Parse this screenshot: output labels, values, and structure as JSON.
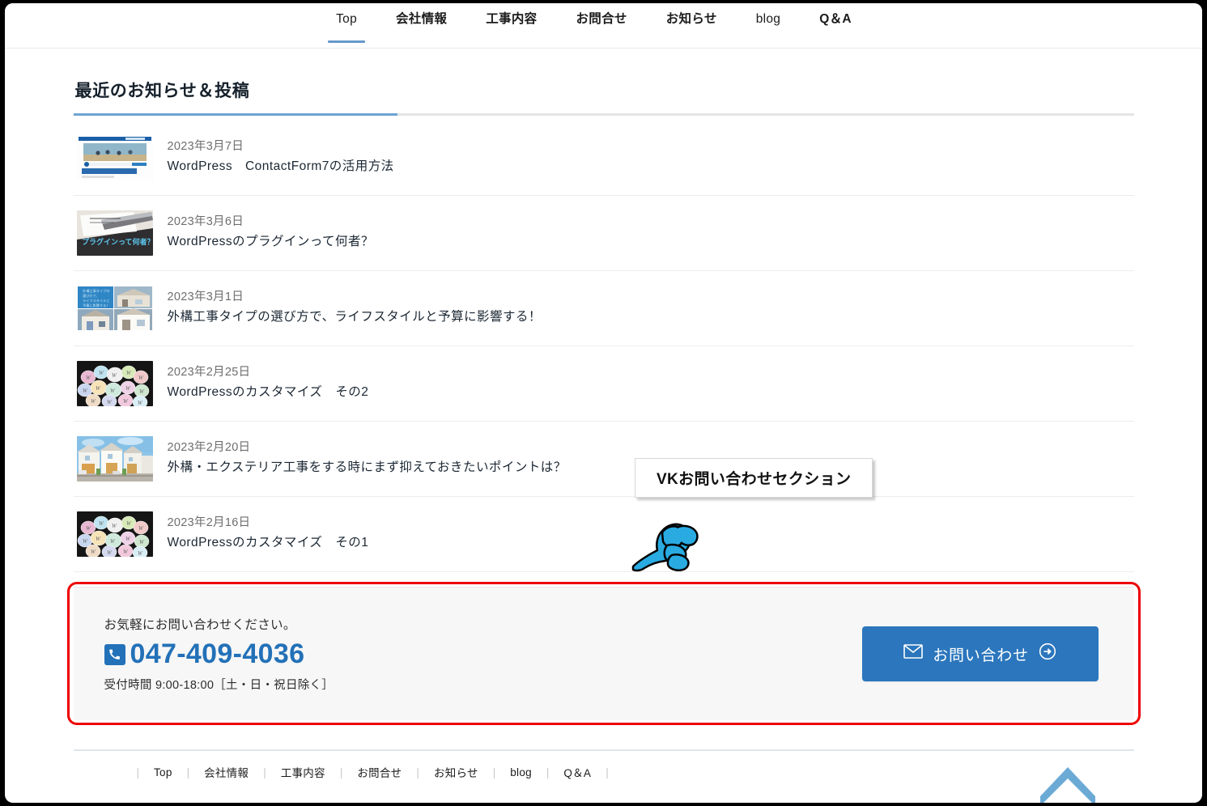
{
  "globalnav": {
    "items": [
      {
        "label": "Top",
        "active": true,
        "bold": false
      },
      {
        "label": "会社情報",
        "active": false,
        "bold": true
      },
      {
        "label": "工事内容",
        "active": false,
        "bold": true
      },
      {
        "label": "お問合せ",
        "active": false,
        "bold": true
      },
      {
        "label": "お知らせ",
        "active": false,
        "bold": true
      },
      {
        "label": "blog",
        "active": false,
        "bold": false
      },
      {
        "label": "Q＆A",
        "active": false,
        "bold": true
      }
    ]
  },
  "section": {
    "title": "最近のお知らせ＆投稿",
    "accent_color": "#6fa3d4"
  },
  "posts": [
    {
      "date": "2023年3月7日",
      "title": "WordPress　ContactForm7の活用方法",
      "thumb": "contactform-screenshot"
    },
    {
      "date": "2023年3月6日",
      "title": "WordPressのプラグインって何者？",
      "thumb": "pen-notebook-photo"
    },
    {
      "date": "2023年3月1日",
      "title": "外構工事タイプの選び方で、ライフスタイルと予算に影響する！",
      "thumb": "exterior-houses-collage"
    },
    {
      "date": "2023年2月25日",
      "title": "WordPressのカスタマイズ　その2",
      "thumb": "wordpress-badges-photo"
    },
    {
      "date": "2023年2月20日",
      "title": "外構・エクステリア工事をする時にまず抑えておきたいポイントは？",
      "thumb": "housing-street-photo"
    },
    {
      "date": "2023年2月16日",
      "title": "WordPressのカスタマイズ　その1",
      "thumb": "wordpress-badges-photo"
    }
  ],
  "contact": {
    "lead": "お気軽にお問い合わせください。",
    "phone": "047-409-4036",
    "hours": "受付時間 9:00-18:00［土・日・祝日除く］",
    "button_label": "お問い合わせ",
    "button_color": "#2b76bd",
    "phone_color": "#2371b8"
  },
  "annotation": {
    "callout_label": "VKお問い合わせセクション",
    "outline_color": "#ee0000",
    "hand_color": "#29ABE2"
  },
  "footer": {
    "items": [
      "Top",
      "会社情報",
      "工事内容",
      "お問合せ",
      "お知らせ",
      "blog",
      "Q＆A"
    ],
    "to_top_color": "#6caad6"
  }
}
